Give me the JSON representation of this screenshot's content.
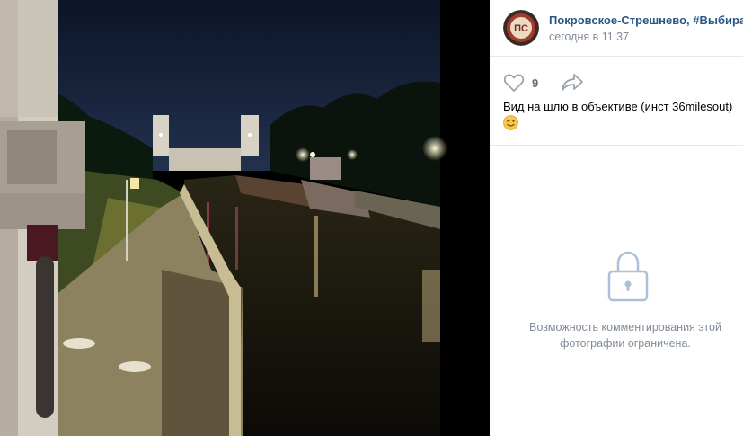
{
  "photo": {
    "description_icon": "river-lock-night-photo"
  },
  "post": {
    "author": "Покровское-Стрешнево, #Выбираем...",
    "time": "сегодня в 11:37",
    "avatar_text": "ПС",
    "likes": "9",
    "caption": "Вид на шлю в объективе (инст 36milesout)",
    "caption_emoji": "winking-face"
  },
  "comments": {
    "restricted_line1": "Возможность комментирования этой",
    "restricted_line2": "фотографии ограничена."
  },
  "colors": {
    "link": "#2a5885",
    "muted": "#818c99",
    "divider": "#e7e8ec",
    "icon": "#99a2ad",
    "lock": "#aec0d8"
  }
}
